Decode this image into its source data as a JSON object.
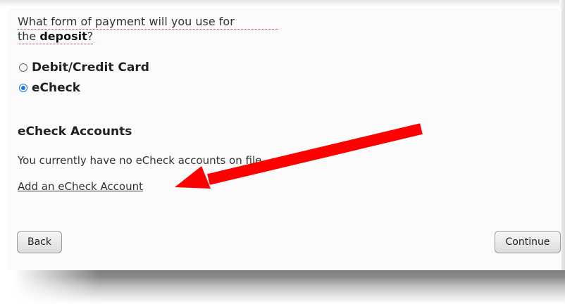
{
  "question": {
    "line1": "What form of payment will you use for",
    "line2_prefix": "the ",
    "line2_bold": "deposit",
    "line2_suffix": "?"
  },
  "payment_options": [
    {
      "label": "Debit/Credit Card",
      "selected": false
    },
    {
      "label": "eCheck",
      "selected": true
    }
  ],
  "echeck": {
    "section_title": "eCheck Accounts",
    "no_accounts_message": "You currently have no eCheck accounts on file.",
    "add_link": "Add an eCheck Account"
  },
  "buttons": {
    "back": "Back",
    "continue": "Continue"
  },
  "annotation": {
    "arrow_color": "#ff0000"
  }
}
